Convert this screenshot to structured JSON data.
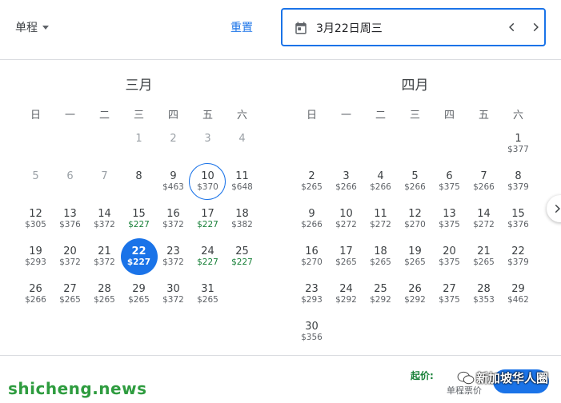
{
  "header": {
    "trip_type": "单程",
    "reset_label": "重置",
    "selected_date": "3月22日周三"
  },
  "weekdays": [
    "日",
    "一",
    "二",
    "三",
    "四",
    "五",
    "六"
  ],
  "months": [
    {
      "title": "三月",
      "lead_blanks": 3,
      "days": [
        {
          "day": "1",
          "price": "",
          "state": "past"
        },
        {
          "day": "2",
          "price": "",
          "state": "past"
        },
        {
          "day": "3",
          "price": "",
          "state": "past"
        },
        {
          "day": "4",
          "price": "",
          "state": "past"
        },
        {
          "day": "5",
          "price": "",
          "state": "past"
        },
        {
          "day": "6",
          "price": "",
          "state": "past"
        },
        {
          "day": "7",
          "price": "",
          "state": "past"
        },
        {
          "day": "8",
          "price": "",
          "state": "normal"
        },
        {
          "day": "9",
          "price": "$463",
          "state": "normal"
        },
        {
          "day": "10",
          "price": "$370",
          "state": "today"
        },
        {
          "day": "11",
          "price": "$648",
          "state": "normal"
        },
        {
          "day": "12",
          "price": "$305",
          "state": "normal"
        },
        {
          "day": "13",
          "price": "$376",
          "state": "normal"
        },
        {
          "day": "14",
          "price": "$372",
          "state": "normal"
        },
        {
          "day": "15",
          "price": "$227",
          "state": "low"
        },
        {
          "day": "16",
          "price": "$372",
          "state": "normal"
        },
        {
          "day": "17",
          "price": "$227",
          "state": "low"
        },
        {
          "day": "18",
          "price": "$382",
          "state": "normal"
        },
        {
          "day": "19",
          "price": "$293",
          "state": "normal"
        },
        {
          "day": "20",
          "price": "$372",
          "state": "normal"
        },
        {
          "day": "21",
          "price": "$372",
          "state": "normal"
        },
        {
          "day": "22",
          "price": "$227",
          "state": "selected"
        },
        {
          "day": "23",
          "price": "$372",
          "state": "normal"
        },
        {
          "day": "24",
          "price": "$227",
          "state": "low"
        },
        {
          "day": "25",
          "price": "$227",
          "state": "low"
        },
        {
          "day": "26",
          "price": "$266",
          "state": "normal"
        },
        {
          "day": "27",
          "price": "$265",
          "state": "normal"
        },
        {
          "day": "28",
          "price": "$265",
          "state": "normal"
        },
        {
          "day": "29",
          "price": "$265",
          "state": "normal"
        },
        {
          "day": "30",
          "price": "$372",
          "state": "normal"
        },
        {
          "day": "31",
          "price": "$265",
          "state": "normal"
        }
      ]
    },
    {
      "title": "四月",
      "lead_blanks": 6,
      "days": [
        {
          "day": "1",
          "price": "$377",
          "state": "normal"
        },
        {
          "day": "2",
          "price": "$265",
          "state": "normal"
        },
        {
          "day": "3",
          "price": "$266",
          "state": "normal"
        },
        {
          "day": "4",
          "price": "$266",
          "state": "normal"
        },
        {
          "day": "5",
          "price": "$266",
          "state": "normal"
        },
        {
          "day": "6",
          "price": "$375",
          "state": "normal"
        },
        {
          "day": "7",
          "price": "$266",
          "state": "normal"
        },
        {
          "day": "8",
          "price": "$379",
          "state": "normal"
        },
        {
          "day": "9",
          "price": "$266",
          "state": "normal"
        },
        {
          "day": "10",
          "price": "$272",
          "state": "normal"
        },
        {
          "day": "11",
          "price": "$272",
          "state": "normal"
        },
        {
          "day": "12",
          "price": "$270",
          "state": "normal"
        },
        {
          "day": "13",
          "price": "$375",
          "state": "normal"
        },
        {
          "day": "14",
          "price": "$272",
          "state": "normal"
        },
        {
          "day": "15",
          "price": "$376",
          "state": "normal"
        },
        {
          "day": "16",
          "price": "$270",
          "state": "normal"
        },
        {
          "day": "17",
          "price": "$265",
          "state": "normal"
        },
        {
          "day": "18",
          "price": "$265",
          "state": "normal"
        },
        {
          "day": "19",
          "price": "$265",
          "state": "normal"
        },
        {
          "day": "20",
          "price": "$375",
          "state": "normal"
        },
        {
          "day": "21",
          "price": "$265",
          "state": "normal"
        },
        {
          "day": "22",
          "price": "$379",
          "state": "normal"
        },
        {
          "day": "23",
          "price": "$293",
          "state": "normal"
        },
        {
          "day": "24",
          "price": "$292",
          "state": "normal"
        },
        {
          "day": "25",
          "price": "$292",
          "state": "normal"
        },
        {
          "day": "26",
          "price": "$292",
          "state": "normal"
        },
        {
          "day": "27",
          "price": "$375",
          "state": "normal"
        },
        {
          "day": "28",
          "price": "$353",
          "state": "normal"
        },
        {
          "day": "29",
          "price": "$462",
          "state": "normal"
        },
        {
          "day": "30",
          "price": "$356",
          "state": "normal"
        }
      ]
    }
  ],
  "footer": {
    "from_label": "起价:",
    "oneway_label": "单程票价",
    "watermark_left": "shicheng.news",
    "watermark_right": "新加坡华人圈"
  },
  "colors": {
    "accent": "#1a73e8",
    "low_price": "#188038"
  }
}
